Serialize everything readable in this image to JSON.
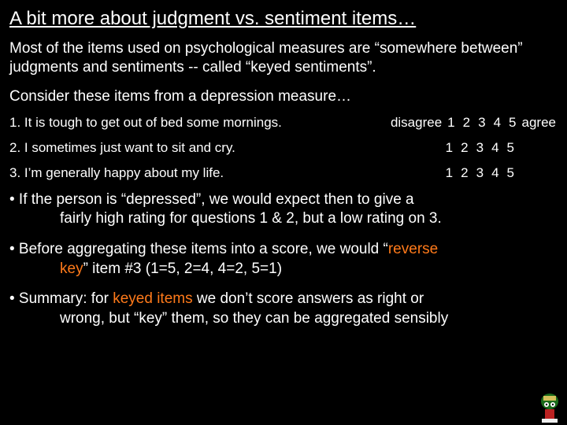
{
  "title": "A bit more about judgment vs. sentiment items…",
  "para1": "Most of the items used on psychological measures are “somewhere between” judgments and sentiments -- called “keyed sentiments”.",
  "sub": "Consider these items from a depression measure…",
  "items": {
    "i1": "1.  It is tough to get out of bed some mornings.",
    "i2": "2.  I sometimes just want to sit and cry.",
    "i3": "3.  I’m generally happy about my life."
  },
  "scale": {
    "low": "disagree",
    "n1": "1",
    "n2": "2",
    "n3": "3",
    "n4": "4",
    "n5": "5",
    "high": "agree"
  },
  "bullets": {
    "b1a": "• If the person is “depressed”, we would expect then to give a",
    "b1b": "fairly high rating for questions 1 & 2, but a low rating on 3.",
    "b2a": "• Before aggregating these items into a score, we would “",
    "b2a_hl": "reverse",
    "b2b_hl": "key",
    "b2b": "” item #3 (1=5, 2=4, 4=2, 5=1)",
    "b3a": "• Summary:  for ",
    "b3a_hl": "keyed items",
    "b3a2": " we don’t score answers as right  or",
    "b3b": "wrong, but “key” them, so they can be aggregated sensibly"
  }
}
